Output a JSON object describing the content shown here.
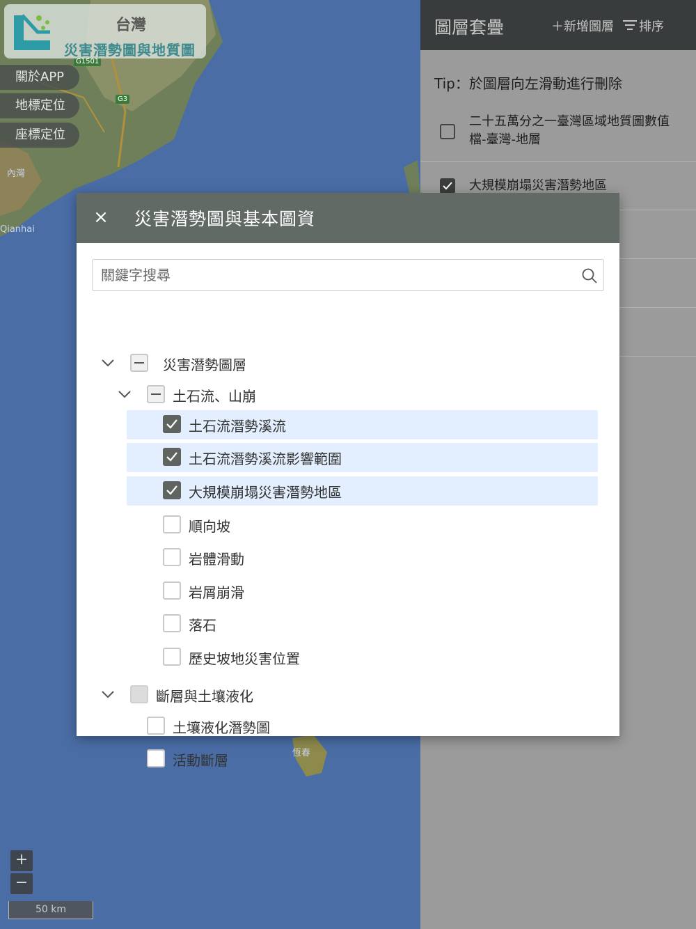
{
  "map": {
    "region_label": "台灣",
    "app_title": "災害潛勢圖與地質圖",
    "place_labels": [
      "內灣",
      "Qianhai",
      "恆春"
    ],
    "road_badges": [
      "G1501",
      "G3"
    ],
    "buttons": [
      "關於APP",
      "地標定位",
      "座標定位"
    ],
    "zoom_in": "+",
    "zoom_out": "−",
    "scale_label": "50 km"
  },
  "panel": {
    "title": "圖層套疊",
    "add_label": "＋新增圖層",
    "sort_label": "排序",
    "tip": "Tip：於圖層向左滑動進行刪除",
    "items": [
      {
        "label": "二十五萬分之一臺灣區域地質圖數值檔-臺灣-地層",
        "checked": false
      },
      {
        "label": "大規模崩塌災害潛勢地區",
        "checked": true
      }
    ]
  },
  "modal": {
    "close_label": "×",
    "title": "災害潛勢圖與基本圖資",
    "search_placeholder": "關鍵字搜尋",
    "tree": [
      {
        "label": "災害潛勢圖層",
        "level": 0,
        "expandable": true,
        "state": "indeterminate"
      },
      {
        "label": "土石流、山崩",
        "level": 1,
        "expandable": true,
        "state": "indeterminate"
      },
      {
        "label": "土石流潛勢溪流",
        "level": 2,
        "state": "checked",
        "highlight": true
      },
      {
        "label": "土石流潛勢溪流影響範圍",
        "level": 2,
        "state": "checked",
        "highlight": true
      },
      {
        "label": "大規模崩塌災害潛勢地區",
        "level": 2,
        "state": "checked",
        "highlight": true
      },
      {
        "label": "順向坡",
        "level": 2,
        "state": "unchecked"
      },
      {
        "label": "岩體滑動",
        "level": 2,
        "state": "unchecked"
      },
      {
        "label": "岩屑崩滑",
        "level": 2,
        "state": "unchecked"
      },
      {
        "label": "落石",
        "level": 2,
        "state": "unchecked"
      },
      {
        "label": "歷史坡地災害位置",
        "level": 2,
        "state": "unchecked"
      },
      {
        "label": "斷層與土壤液化",
        "level": 0,
        "expandable": true,
        "state": "disabled"
      },
      {
        "label": "土壤液化潛勢圖",
        "level": 1,
        "state": "unchecked"
      },
      {
        "label": "活動斷層",
        "level": 1,
        "state": "unchecked"
      }
    ]
  },
  "colors": {
    "modal_header": "#616a65",
    "highlight_row": "#e3efff",
    "checkbox_checked": "#5f6461",
    "panel_header": "#383c3c"
  }
}
